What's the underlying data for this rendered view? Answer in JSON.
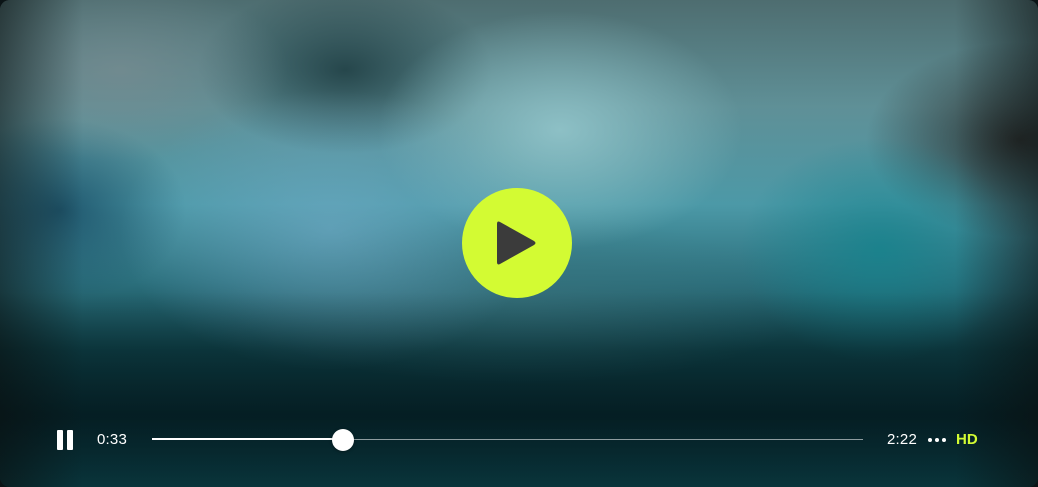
{
  "colors": {
    "accent": "#d3fb33",
    "play_glyph": "#3b3b3b",
    "text": "#ffffff"
  },
  "player": {
    "center_play_icon": "play-icon",
    "pause_icon": "pause-icon",
    "more_icon": "more-horizontal-icon",
    "current_time": "0:33",
    "total_time": "2:22",
    "progress_fraction": 0.268,
    "quality_label": "HD"
  }
}
